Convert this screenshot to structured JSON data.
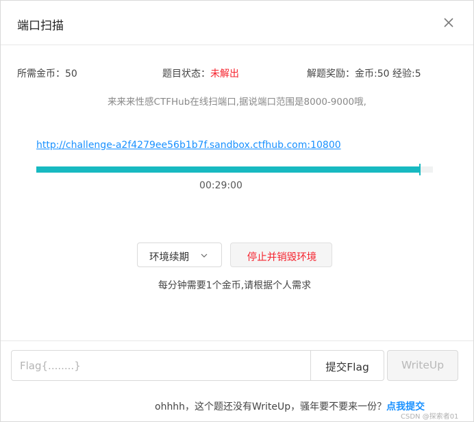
{
  "dialog": {
    "title": "端口扫描",
    "close_icon": "close-icon"
  },
  "info": {
    "cost_label": "所需金币：",
    "cost_value": "50",
    "status_label": "题目状态：",
    "status_value": "未解出",
    "status_color": "#f5222d",
    "reward_label": "解题奖励：",
    "reward_value": "金币:50 经验:5"
  },
  "description": "来来来性感CTFHub在线扫端口,据说端口范围是8000-9000哦,",
  "environment": {
    "url": "http://challenge-a2f4279ee56b1b7f.sandbox.ctfhub.com:10800",
    "remaining_fraction": 0.967,
    "timer": "00:29:00",
    "progress_color": "#17b9c1"
  },
  "actions": {
    "renew_label": "环境续期",
    "renew_icon": "chevron-down-icon",
    "stop_label": "停止并销毁环境",
    "note": "每分钟需要1个金币,请根据个人需求"
  },
  "flag": {
    "placeholder": "Flag{........}",
    "value": "",
    "submit_label": "提交Flag",
    "writeup_label": "WriteUp"
  },
  "footer": {
    "text": "ohhhh，这个题还没有WriteUp，骚年要不要来一份？",
    "link": "点我提交",
    "watermark": "CSDN @探索者01"
  }
}
